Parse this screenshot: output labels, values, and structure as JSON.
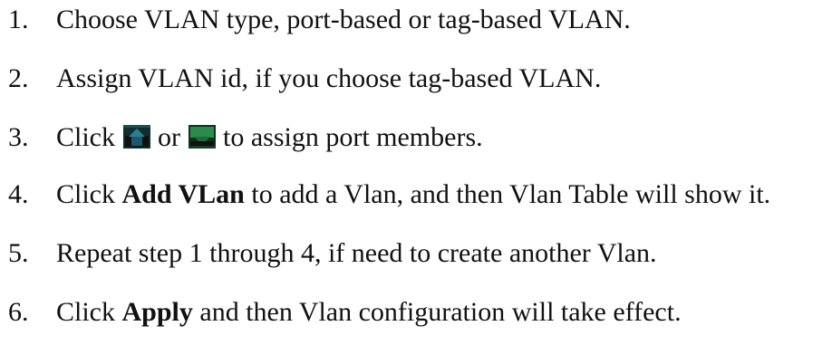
{
  "steps": [
    {
      "number": "1.",
      "text": "Choose VLAN type, port-based or tag-based VLAN."
    },
    {
      "number": "2.",
      "text": "Assign VLAN id, if you choose tag-based VLAN."
    },
    {
      "number": "3.",
      "prefix": "Click",
      "middle": "or",
      "suffix": "to assign port members.",
      "icon_a": "untagged-port-icon",
      "icon_b": "tagged-port-icon"
    },
    {
      "number": "4.",
      "prefix": "Click",
      "bold": "Add VLan",
      "suffix": "to add a Vlan, and then Vlan Table will show it."
    },
    {
      "number": "5.",
      "text": "Repeat step 1 through 4, if need to create another Vlan."
    },
    {
      "number": "6.",
      "prefix": "Click",
      "bold": "Apply",
      "suffix": "and then Vlan configuration will take effect."
    }
  ],
  "colors": {
    "text": "#111111",
    "icon_dark": "#111111",
    "icon_tagged": "#1f6b3a",
    "icon_untagged": "#1a5a6a"
  }
}
